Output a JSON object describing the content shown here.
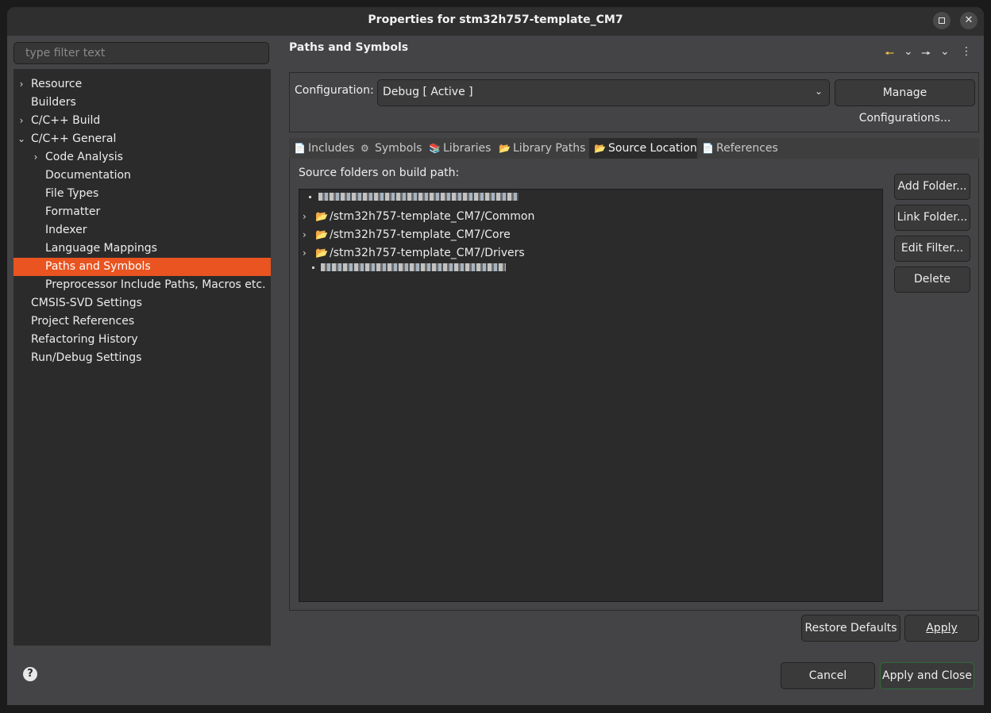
{
  "window": {
    "title": "Properties for stm32h757-template_CM7",
    "close_glyph": "✕"
  },
  "filter": {
    "placeholder": "type filter text"
  },
  "tree": {
    "items": [
      {
        "label": "Resource",
        "chevron": "›"
      },
      {
        "label": "Builders",
        "chevron": ""
      },
      {
        "label": "C/C++ Build",
        "chevron": "›"
      },
      {
        "label": "C/C++ General",
        "chevron": "⌄"
      },
      {
        "label": "Code Analysis",
        "chevron": "›"
      },
      {
        "label": "Documentation",
        "chevron": ""
      },
      {
        "label": "File Types",
        "chevron": ""
      },
      {
        "label": "Formatter",
        "chevron": ""
      },
      {
        "label": "Indexer",
        "chevron": ""
      },
      {
        "label": "Language Mappings",
        "chevron": ""
      },
      {
        "label": "Paths and Symbols",
        "chevron": "",
        "selected": true
      },
      {
        "label": "Preprocessor Include Paths, Macros etc.",
        "chevron": ""
      },
      {
        "label": "CMSIS-SVD Settings",
        "chevron": ""
      },
      {
        "label": "Project References",
        "chevron": ""
      },
      {
        "label": "Refactoring History",
        "chevron": ""
      },
      {
        "label": "Run/Debug Settings",
        "chevron": ""
      }
    ]
  },
  "page": {
    "title": "Paths and Symbols",
    "nav_icons": [
      "back-arrow-icon",
      "chevron-down-icon",
      "forward-arrow-icon",
      "chevron-down-icon",
      "kebab-menu-icon"
    ],
    "nav_glyphs": {
      "back": "🠔",
      "dropdown": "⌄",
      "forward": "🠖",
      "menu": "⋮"
    }
  },
  "configuration": {
    "label": "Configuration:",
    "value": "Debug  [ Active ]",
    "manage_button": "Manage Configurations..."
  },
  "tabs": [
    {
      "label": "Includes",
      "icon": "includes-icon",
      "glyph": "📄"
    },
    {
      "label": "Symbols",
      "icon": "symbols-icon",
      "glyph": "⚙"
    },
    {
      "label": "Libraries",
      "icon": "libraries-icon",
      "glyph": "📚"
    },
    {
      "label": "Library Paths",
      "icon": "library-paths-icon",
      "glyph": "📂"
    },
    {
      "label": "Source Location",
      "icon": "source-folder-icon",
      "glyph": "📂",
      "active": true
    },
    {
      "label": "References",
      "icon": "references-icon",
      "glyph": "📄"
    }
  ],
  "source": {
    "label": "Source folders on build path:",
    "folders": [
      "/stm32h757-template_CM7/Common",
      "/stm32h757-template_CM7/Core",
      "/stm32h757-template_CM7/Drivers"
    ],
    "folder_chevron": "›",
    "folder_glyph": "📂"
  },
  "side_buttons": {
    "add_folder": "Add Folder...",
    "link_folder": "Link Folder...",
    "edit_filter": "Edit Filter...",
    "delete": "Delete"
  },
  "bottom": {
    "restore_defaults": "Restore Defaults",
    "apply": "Apply",
    "cancel": "Cancel",
    "apply_and_close": "Apply and Close",
    "help_glyph": "?"
  },
  "colors": {
    "selection": "#e95420",
    "folder": "#e8b04a",
    "apply_close_border": "#2e6b3a"
  }
}
